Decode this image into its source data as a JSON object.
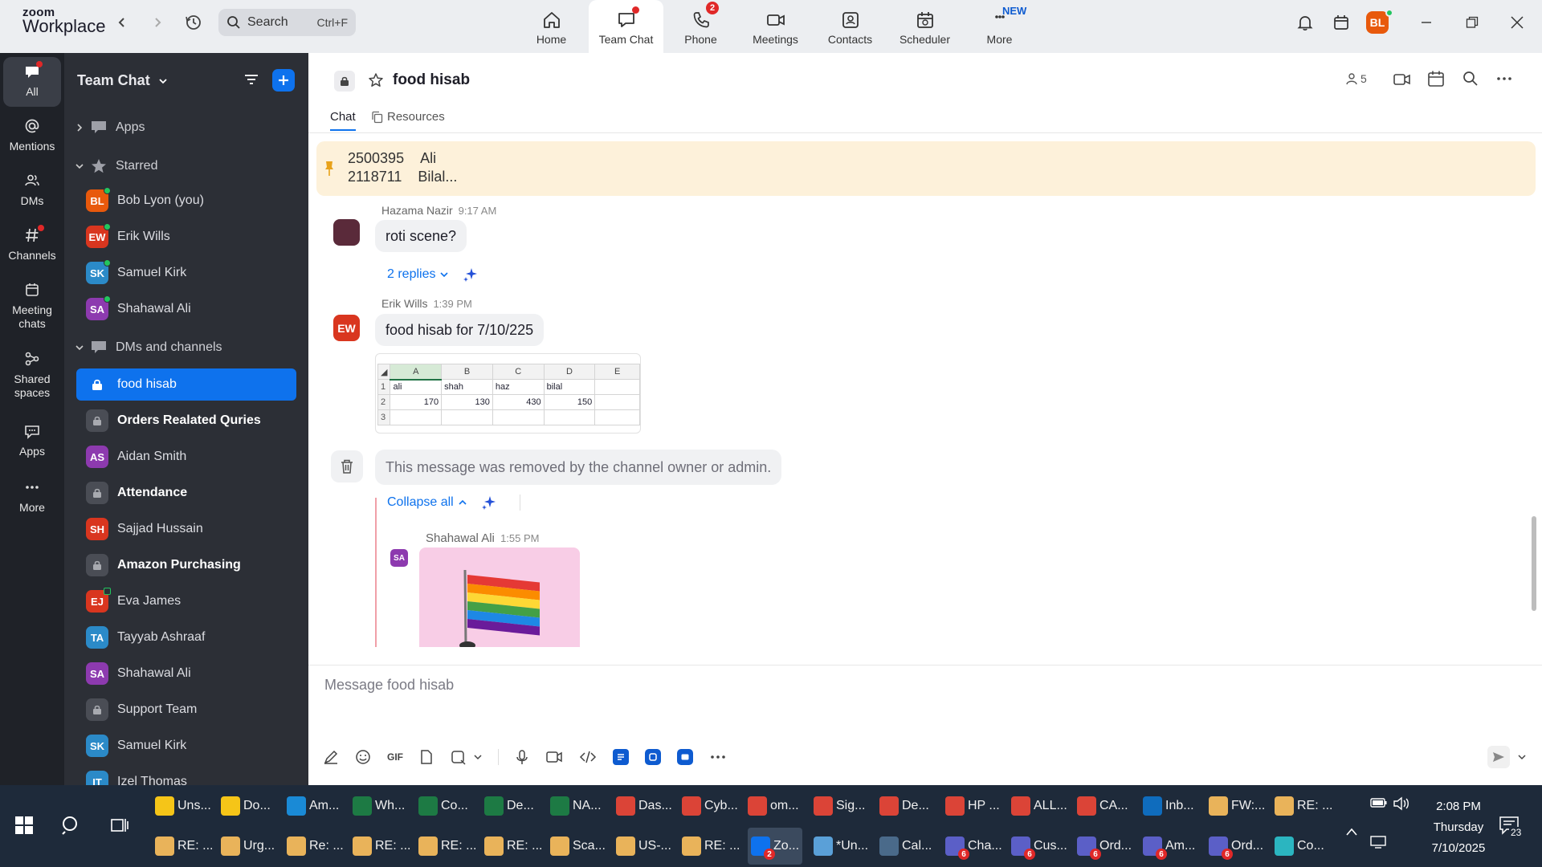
{
  "app": {
    "brand_top": "zoom",
    "brand_bottom": "Workplace",
    "search_label": "Search",
    "search_shortcut": "Ctrl+F",
    "profile_initials": "BL",
    "profile_color": "#e8590c"
  },
  "top_tabs": [
    {
      "label": "Home",
      "icon": "home-icon",
      "badge": null
    },
    {
      "label": "Team Chat",
      "icon": "chat-icon",
      "badge": "dot"
    },
    {
      "label": "Phone",
      "icon": "phone-icon",
      "badge": "2"
    },
    {
      "label": "Meetings",
      "icon": "video-icon",
      "badge": null
    },
    {
      "label": "Contacts",
      "icon": "contacts-icon",
      "badge": null
    },
    {
      "label": "Scheduler",
      "icon": "calendar-icon",
      "badge": null
    },
    {
      "label": "More",
      "icon": "more-icon",
      "badge": "NEW"
    }
  ],
  "rail": [
    {
      "label": "All",
      "icon": "chat-icon",
      "active": true
    },
    {
      "label": "Mentions",
      "icon": "at-icon",
      "active": false
    },
    {
      "label": "DMs",
      "icon": "people-icon",
      "active": false
    },
    {
      "label": "Channels",
      "icon": "hash-icon",
      "active": false
    },
    {
      "label": "Meeting chats",
      "icon": "calendar-icon",
      "active": false
    },
    {
      "label": "Shared spaces",
      "icon": "shared-icon",
      "active": false
    },
    {
      "label": "Apps",
      "icon": "apps-icon",
      "active": false
    },
    {
      "label": "More",
      "icon": "ellipsis-icon",
      "active": false
    }
  ],
  "sidebar": {
    "title": "Team Chat",
    "apps_label": "Apps",
    "starred_label": "Starred",
    "dms_label": "DMs and channels",
    "starred": [
      {
        "initials": "BL",
        "name": "Bob Lyon (you)",
        "color": "#e8590c"
      },
      {
        "initials": "EW",
        "name": "Erik Wills",
        "color": "#d9361f"
      },
      {
        "initials": "SK",
        "name": "Samuel Kirk",
        "color": "#2b8ac8"
      },
      {
        "initials": "SA",
        "name": "Shahawal Ali",
        "color": "#8d3aaf"
      }
    ],
    "channels": [
      {
        "type": "lock",
        "name": "food hisab",
        "selected": true,
        "bold": false
      },
      {
        "type": "lock",
        "name": "Orders Realated Quries",
        "selected": false,
        "bold": true
      },
      {
        "type": "avatar",
        "initials": "AS",
        "name": "Aidan Smith",
        "color": "#8d3aaf"
      },
      {
        "type": "lock",
        "name": "Attendance",
        "selected": false,
        "bold": true
      },
      {
        "type": "avatar",
        "initials": "SH",
        "name": "Sajjad Hussain",
        "color": "#d9361f"
      },
      {
        "type": "lock",
        "name": "Amazon Purchasing",
        "selected": false,
        "bold": true
      },
      {
        "type": "avatar",
        "initials": "EJ",
        "name": "Eva James",
        "color": "#d9361f"
      },
      {
        "type": "avatar",
        "initials": "TA",
        "name": "Tayyab Ashraaf",
        "color": "#2b8ac8"
      },
      {
        "type": "avatar",
        "initials": "SA",
        "name": "Shahawal Ali",
        "color": "#8d3aaf"
      },
      {
        "type": "lock",
        "name": "Support Team",
        "selected": false,
        "bold": false
      },
      {
        "type": "avatar",
        "initials": "SK",
        "name": "Samuel Kirk",
        "color": "#2b8ac8"
      },
      {
        "type": "avatar",
        "initials": "IT",
        "name": "Izel Thomas",
        "color": "#2b8ac8"
      }
    ]
  },
  "channel": {
    "name": "food hisab",
    "member_count": "5",
    "tab_chat": "Chat",
    "tab_resources": "Resources"
  },
  "pinned": {
    "line1_num": "2500395",
    "line1_name": "Ali",
    "line2_num": "2118711",
    "line2_name": "Bilal..."
  },
  "messages": [
    {
      "sender": "Hazama Nazir",
      "time": "9:17 AM",
      "text": "roti scene?",
      "replies": "2 replies"
    },
    {
      "sender": "Erik Wills",
      "initials": "EW",
      "time": "1:39 PM",
      "text": "food hisab for 7/10/225"
    },
    {
      "removed": "This message was removed by the channel owner or admin.",
      "collapse": "Collapse all"
    },
    {
      "sender": "Shahawal Ali",
      "initials": "SA",
      "time": "1:55 PM"
    }
  ],
  "sheet": {
    "cols": [
      "A",
      "B",
      "C",
      "D",
      "E"
    ],
    "rows": [
      {
        "n": "1",
        "cells": [
          "ali",
          "shah",
          "haz",
          "bilal",
          ""
        ]
      },
      {
        "n": "2",
        "cells": [
          "170",
          "130",
          "430",
          "150",
          ""
        ]
      },
      {
        "n": "3",
        "cells": [
          "",
          "",
          "",
          "",
          ""
        ]
      }
    ]
  },
  "composer": {
    "placeholder": "Message food hisab",
    "gif": "GIF"
  },
  "taskbar": {
    "row1": [
      {
        "label": "Uns...",
        "color": "#f5c518"
      },
      {
        "label": "Do...",
        "color": "#f5c518"
      },
      {
        "label": "Am...",
        "color": "#1a8ad6"
      },
      {
        "label": "Wh...",
        "color": "#1d7a44"
      },
      {
        "label": "Co...",
        "color": "#1d7a44"
      },
      {
        "label": "De...",
        "color": "#1d7a44"
      },
      {
        "label": "NA...",
        "color": "#1d7a44"
      },
      {
        "label": "Das...",
        "color": "#db4437"
      },
      {
        "label": "Cyb...",
        "color": "#db4437"
      },
      {
        "label": "om...",
        "color": "#db4437"
      },
      {
        "label": "Sig...",
        "color": "#db4437"
      },
      {
        "label": "De...",
        "color": "#db4437"
      },
      {
        "label": "HP ...",
        "color": "#db4437"
      },
      {
        "label": "ALL...",
        "color": "#db4437"
      },
      {
        "label": "CA...",
        "color": "#db4437"
      },
      {
        "label": "Inb...",
        "color": "#0f6cbd"
      },
      {
        "label": "FW:...",
        "color": "#e9b35a"
      },
      {
        "label": "RE: ...",
        "color": "#e9b35a"
      }
    ],
    "row2": [
      {
        "label": "RE: ...",
        "color": "#e9b35a",
        "badge": ""
      },
      {
        "label": "Urg...",
        "color": "#e9b35a",
        "badge": ""
      },
      {
        "label": "Re: ...",
        "color": "#e9b35a",
        "badge": ""
      },
      {
        "label": "RE: ...",
        "color": "#e9b35a",
        "badge": ""
      },
      {
        "label": "RE: ...",
        "color": "#e9b35a",
        "badge": ""
      },
      {
        "label": "RE: ...",
        "color": "#e9b35a",
        "badge": ""
      },
      {
        "label": "Sca...",
        "color": "#e9b35a",
        "badge": ""
      },
      {
        "label": "US-...",
        "color": "#e9b35a",
        "badge": ""
      },
      {
        "label": "RE: ...",
        "color": "#e9b35a",
        "badge": ""
      },
      {
        "label": "Zo...",
        "color": "#0e72ed",
        "badge": "2"
      },
      {
        "label": "*Un...",
        "color": "#5aa0d8",
        "badge": ""
      },
      {
        "label": "Cal...",
        "color": "#4a6a8a",
        "badge": ""
      },
      {
        "label": "Cha...",
        "color": "#5b5fc7",
        "badge": "6"
      },
      {
        "label": "Cus...",
        "color": "#5b5fc7",
        "badge": "6"
      },
      {
        "label": "Ord...",
        "color": "#5b5fc7",
        "badge": "6"
      },
      {
        "label": "Am...",
        "color": "#5b5fc7",
        "badge": "6"
      },
      {
        "label": "Ord...",
        "color": "#5b5fc7",
        "badge": "6"
      },
      {
        "label": "Co...",
        "color": "#2bb5c0",
        "badge": ""
      }
    ],
    "time": "2:08 PM",
    "day": "Thursday",
    "date": "7/10/2025",
    "notifications": "23"
  }
}
